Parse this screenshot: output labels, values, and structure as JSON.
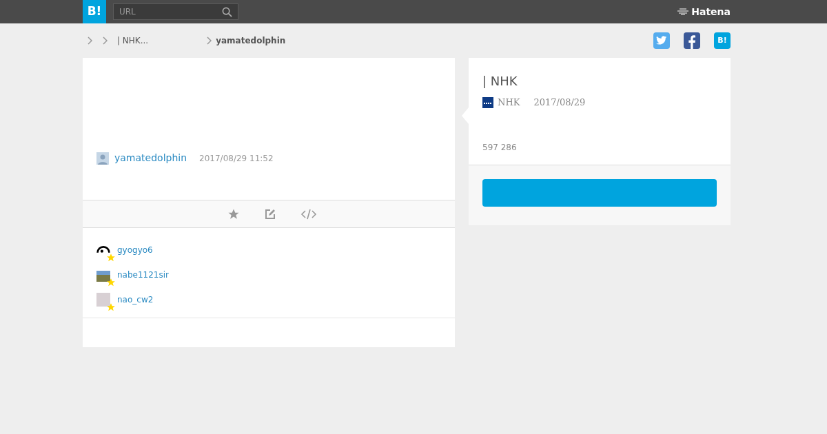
{
  "header": {
    "logo": "B!",
    "search": {
      "placeholder": "URL"
    },
    "brand": "Hatena"
  },
  "breadcrumb": {
    "items": [
      {
        "label": "| NHK...",
        "current": false
      },
      {
        "label": "yamatedolphin",
        "current": true
      }
    ]
  },
  "share": [
    {
      "kind": "twitter"
    },
    {
      "kind": "facebook"
    },
    {
      "kind": "hatena",
      "label": "B!"
    }
  ],
  "bookmark": {
    "user": "yamatedolphin",
    "time": "2017/08/29 11:52"
  },
  "stars": [
    {
      "user": "gyogyo6",
      "kind": "drawing"
    },
    {
      "user": "nabe1121sir",
      "kind": "landscape"
    },
    {
      "user": "nao_cw2",
      "kind": "illustration"
    }
  ],
  "entry": {
    "title": "| NHK",
    "source": "NHK",
    "date": "2017/08/29",
    "count": "597 286"
  }
}
